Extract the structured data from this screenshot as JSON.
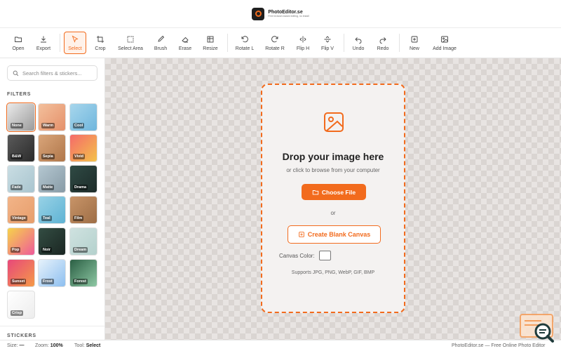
{
  "header": {
    "brand": "PhotoEditor.se",
    "tagline": "Free browser-based editing, no install"
  },
  "toolbar": {
    "tools": [
      {
        "label": "Open",
        "icon": "folder-icon"
      },
      {
        "label": "Export",
        "icon": "download-icon"
      },
      {
        "label": "Select",
        "icon": "cursor-icon",
        "active": true
      },
      {
        "label": "Crop",
        "icon": "crop-icon"
      },
      {
        "label": "Select Area",
        "icon": "select-area-icon"
      },
      {
        "label": "Brush",
        "icon": "brush-icon"
      },
      {
        "label": "Erase",
        "icon": "eraser-icon"
      },
      {
        "label": "Resize",
        "icon": "resize-icon"
      },
      {
        "label": "Rotate L",
        "icon": "rotate-left-icon"
      },
      {
        "label": "Rotate R",
        "icon": "rotate-right-icon"
      },
      {
        "label": "Flip H",
        "icon": "flip-horizontal-icon"
      },
      {
        "label": "Flip V",
        "icon": "flip-vertical-icon"
      },
      {
        "label": "Undo",
        "icon": "undo-icon"
      },
      {
        "label": "Redo",
        "icon": "redo-icon"
      },
      {
        "label": "New",
        "icon": "plus-square-icon"
      },
      {
        "label": "Add Image",
        "icon": "image-icon"
      }
    ]
  },
  "sidebar": {
    "search_placeholder": "Search filters & stickers...",
    "filters_title": "FILTERS",
    "stickers_title": "STICKERS",
    "filters": [
      {
        "name": "None",
        "selected": true
      },
      {
        "name": "Warm"
      },
      {
        "name": "Cool"
      },
      {
        "name": "B&W"
      },
      {
        "name": "Sepia"
      },
      {
        "name": "Vivid"
      },
      {
        "name": "Fade"
      },
      {
        "name": "Matte"
      },
      {
        "name": "Drama"
      },
      {
        "name": "Vintage"
      },
      {
        "name": "Teal"
      },
      {
        "name": "Film"
      },
      {
        "name": "Pop"
      },
      {
        "name": "Noir"
      },
      {
        "name": "Dream"
      },
      {
        "name": "Sunset"
      },
      {
        "name": "Frost"
      },
      {
        "name": "Forest"
      },
      {
        "name": "Crisp"
      }
    ]
  },
  "dropzone": {
    "title": "Drop your image here",
    "subtitle": "or click to browse from your computer",
    "choose_label": "Choose File",
    "or_text": "or",
    "blank_label": "Create Blank Canvas",
    "color_label": "Canvas Color:",
    "color_value": "#ffffff",
    "formats": "Supports JPG, PNG, WebP, GIF, BMP"
  },
  "status": {
    "size_label": "Size:",
    "size_value": "—",
    "zoom_label": "Zoom:",
    "zoom_value": "100%",
    "tool_label": "Tool:",
    "tool_value": "Select",
    "footer": "PhotoEditor.se — Free Online Photo Editor"
  },
  "colors": {
    "accent": "#f26b1d"
  }
}
